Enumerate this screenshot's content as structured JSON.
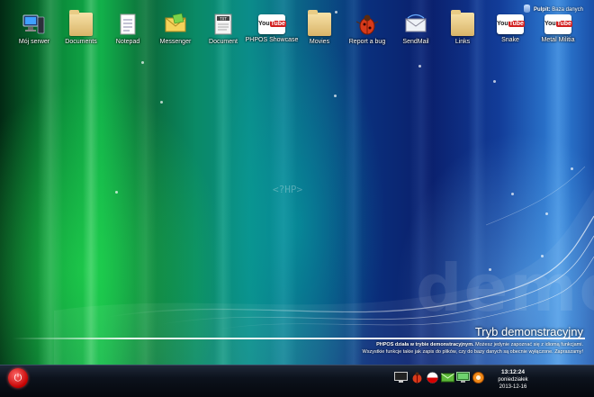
{
  "desktop": {
    "icons": [
      {
        "label": "Mój serwer",
        "icon": "server-icon"
      },
      {
        "label": "Documents",
        "icon": "folder-icon"
      },
      {
        "label": "Notepad",
        "icon": "notepad-icon"
      },
      {
        "label": "Messenger",
        "icon": "messenger-icon"
      },
      {
        "label": "Document",
        "icon": "document-icon"
      },
      {
        "label": "PHPOS Showcase",
        "icon": "youtube-icon"
      },
      {
        "label": "Movies",
        "icon": "folder-icon"
      },
      {
        "label": "Report a bug",
        "icon": "bug-icon"
      },
      {
        "label": "SendMail",
        "icon": "mail-icon"
      },
      {
        "label": "Links",
        "icon": "folder-icon"
      },
      {
        "label": "Snake",
        "icon": "youtube-icon"
      },
      {
        "label": "Metal Militia",
        "icon": "youtube-icon"
      }
    ],
    "watermark": "demo",
    "center_logo": "<?HP>"
  },
  "user_area": {
    "label": "Pulpit:",
    "value": "Baza danych"
  },
  "demo": {
    "title": "Tryb demonstracyjny",
    "bold_text": "PHPOS działa w trybie demonstracyjnym.",
    "line1": " Możesz jedynie zapoznać się z idiomą funkcjami.",
    "line2": "Wszystkie funkcje takie jak zapis do plików, czy do bazy danych są obecnie wyłączone. Zapraszamy!"
  },
  "taskbar": {
    "tray_icons": [
      "monitor-icon",
      "bug-icon",
      "flag-icon",
      "mail-icon",
      "network-icon",
      "settings-icon"
    ],
    "clock": {
      "time": "13:12:24",
      "day": "poniedziałek",
      "date": "2013-12-16"
    }
  },
  "colors": {
    "youtube_red": "#d21f1f",
    "power_red": "#c40000"
  }
}
